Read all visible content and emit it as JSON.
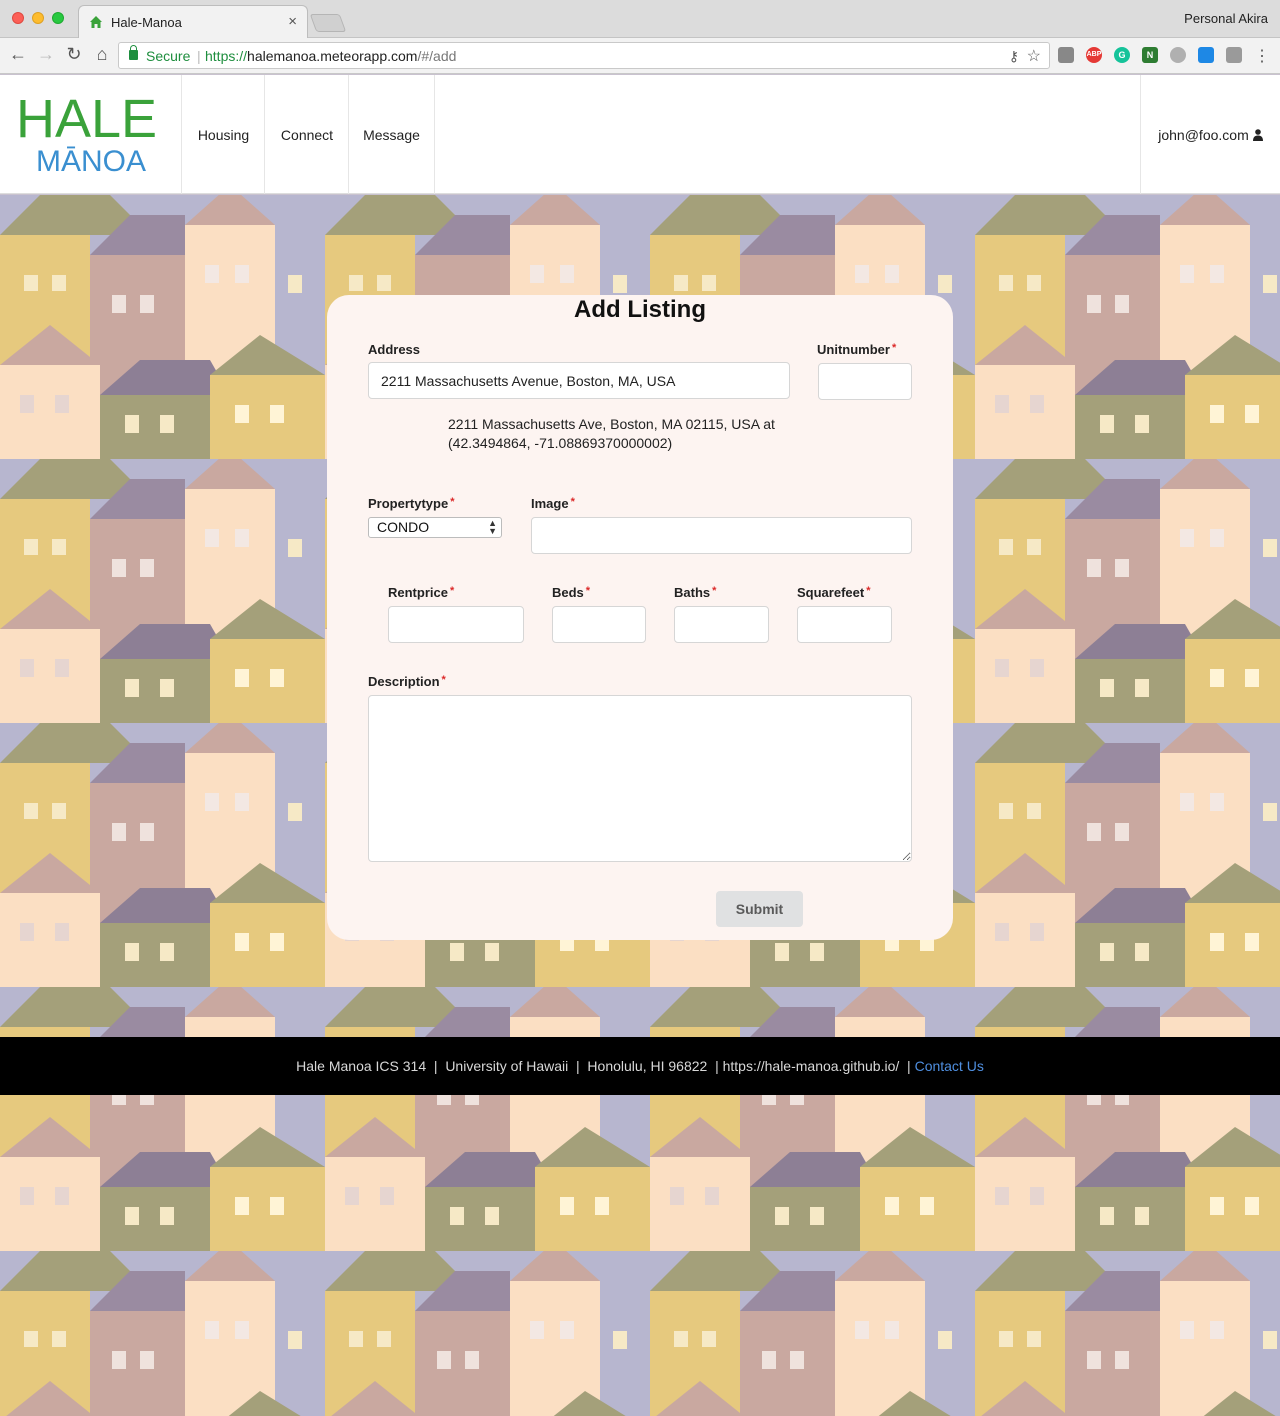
{
  "browser": {
    "tab_title": "Hale-Manoa",
    "tab_close": "×",
    "profile": "Personal Akira",
    "secure_label": "Secure",
    "url_sep": "|",
    "url_https": "https://",
    "url_host": "halemanoa.meteorapp.com",
    "url_path": "/#/add",
    "nav": {
      "back": "←",
      "forward": "→",
      "reload": "↻",
      "home": "⌂"
    },
    "icons": {
      "key": "⚷",
      "star": "☆",
      "menu": "⋮"
    },
    "extensions": [
      {
        "name": "cast-icon",
        "color": "#7a7a7a"
      },
      {
        "name": "adblock-icon",
        "color": "#e53935"
      },
      {
        "name": "grammarly-icon",
        "color": "#15c39a"
      },
      {
        "name": "evernote-icon",
        "color": "#2e7d32"
      },
      {
        "name": "palette-icon",
        "color": "#9e9e9e"
      },
      {
        "name": "react-devtools-icon",
        "color": "#1e88e5"
      },
      {
        "name": "screenshot-icon",
        "color": "#8d8d8d"
      }
    ],
    "extension_labels": {
      "adblock": "ABP",
      "grammarly": "G",
      "evernote": "N"
    }
  },
  "header": {
    "logo_top": "HALE",
    "logo_bottom": "MĀNOA",
    "nav_items": [
      "Housing",
      "Connect",
      "Message"
    ],
    "user_email": "john@foo.com"
  },
  "form": {
    "title": "Add Listing",
    "address_label": "Address",
    "address_value": "2211 Massachusetts Avenue, Boston, MA, USA",
    "address_result_line1": "2211 Massachusetts Ave, Boston, MA 02115, USA at",
    "address_result_line2": "(42.3494864, -71.08869370000002)",
    "unitnumber_label": "Unitnumber",
    "propertytype_label": "Propertytype",
    "propertytype_value": "CONDO",
    "image_label": "Image",
    "rentprice_label": "Rentprice",
    "beds_label": "Beds",
    "baths_label": "Baths",
    "squarefeet_label": "Squarefeet",
    "description_label": "Description",
    "required_mark": "*",
    "submit_label": "Submit"
  },
  "footer": {
    "text": "Hale Manoa ICS 314  |  University of Hawaii  |  Honolulu, HI 96822  | https://hale-manoa.github.io/  | ",
    "contact_label": "Contact Us"
  },
  "colors": {
    "logo_green": "#3aa23a",
    "logo_blue": "#3a8fd0",
    "card_bg": "#fdf4f1",
    "footer_bg": "#000000",
    "required": "#db2828",
    "contact_link": "#4f8fe0"
  }
}
